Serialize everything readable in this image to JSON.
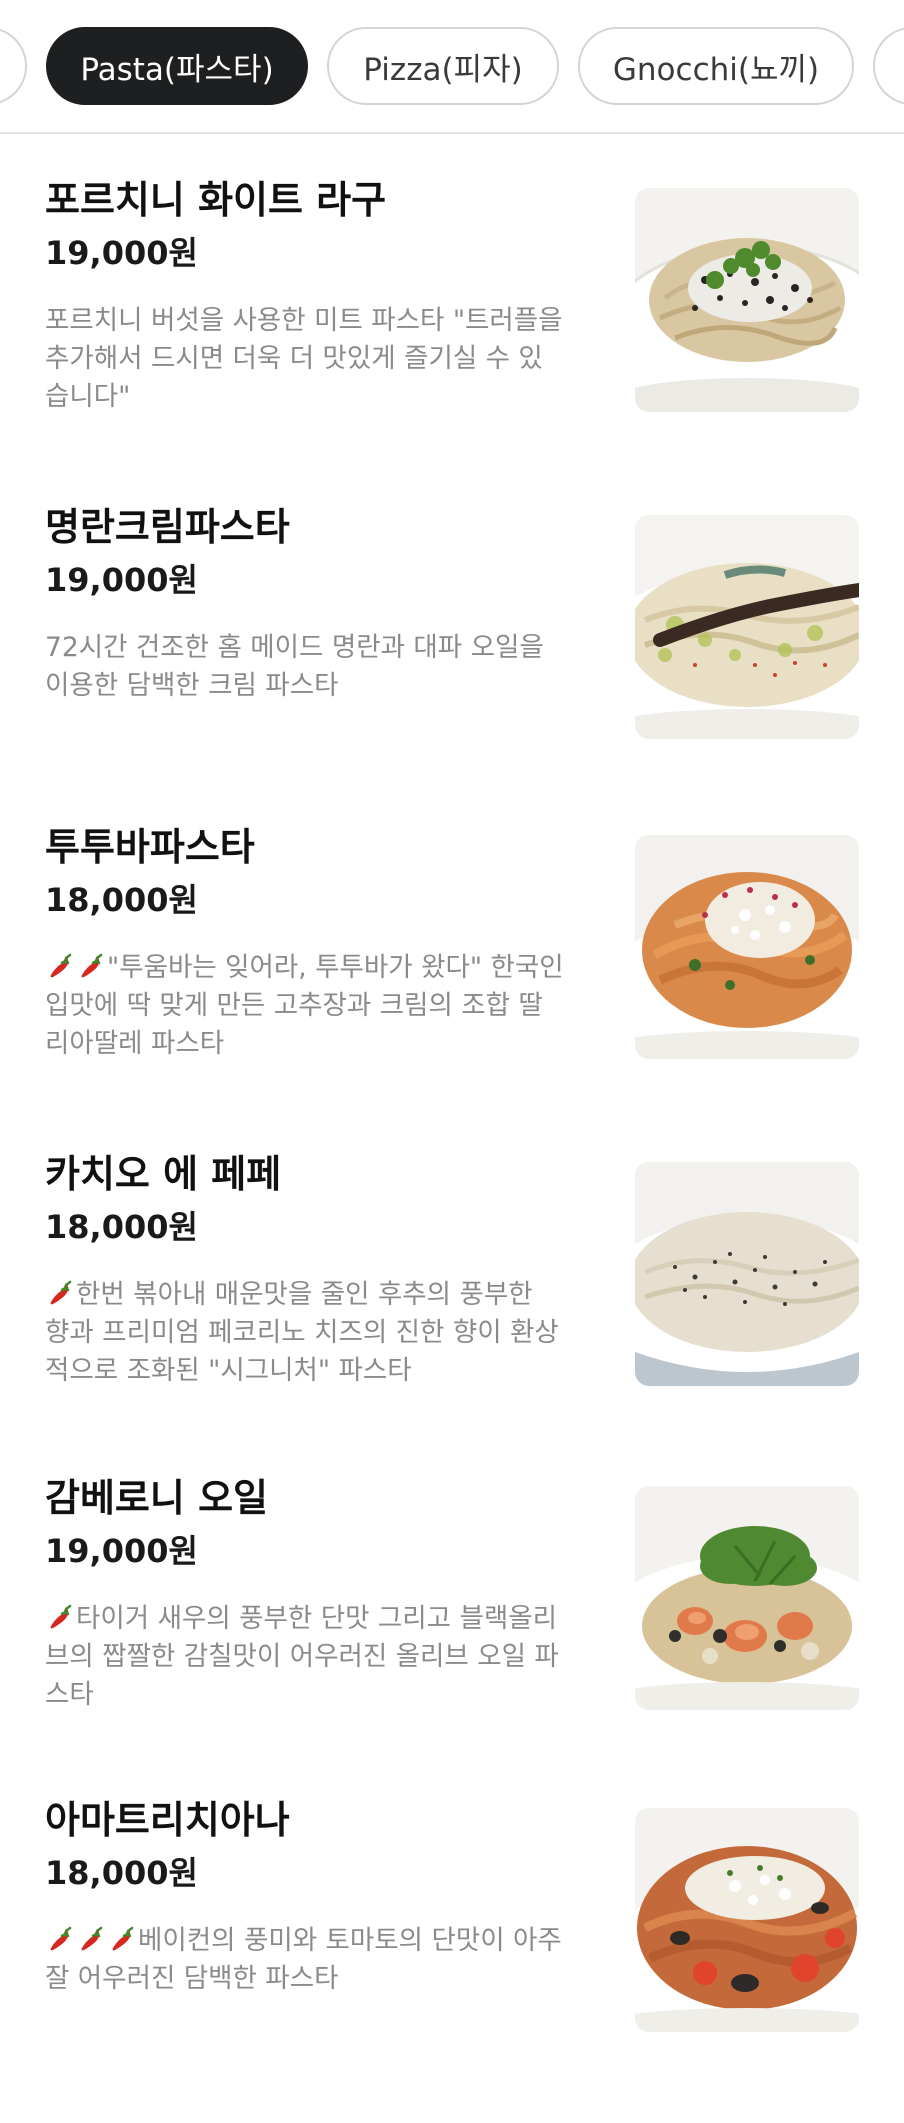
{
  "categories": {
    "prev_label": "",
    "items": [
      {
        "label": "Pasta(파스타)",
        "active": true
      },
      {
        "label": "Pizza(피자)",
        "active": false
      },
      {
        "label": "Gnocchi(뇨끼)",
        "active": false
      }
    ],
    "next_label": ""
  },
  "menu": [
    {
      "name": "포르치니 화이트 라구",
      "price": "19,000원",
      "spice_level": 0,
      "description": "포르치니 버섯을 사용한 미트 파스타 \"트러플을 추가해서 드시면 더욱 더 맛있게 즐기실 수 있습니다\"",
      "image": "porcini-white-ragu-photo"
    },
    {
      "name": "명란크림파스타",
      "price": "19,000원",
      "spice_level": 0,
      "description": "72시간 건조한 홈 메이드 명란과 대파 오일을 이용한 담백한 크림 파스타",
      "image": "myeongran-cream-pasta-photo"
    },
    {
      "name": "투투바파스타",
      "price": "18,000원",
      "spice_level": 2,
      "description": "\"투움바는 잊어라, 투투바가 왔다\" 한국인 입맛에 딱 맞게 만든 고추장과 크림의 조합 딸리아딸레 파스타",
      "image": "tutuba-pasta-photo"
    },
    {
      "name": "카치오 에 페페",
      "price": "18,000원",
      "spice_level": 1,
      "description": "한번 볶아내 매운맛을 줄인 후추의 풍부한 향과 프리미엄 페코리노 치즈의 진한 향이 환상적으로 조화된 \"시그니처\" 파스타",
      "image": "cacio-e-pepe-photo"
    },
    {
      "name": "감베로니 오일",
      "price": "19,000원",
      "spice_level": 1,
      "description": "타이거 새우의 풍부한 단맛 그리고 블랙올리브의 짭짤한 감칠맛이 어우러진 올리브 오일 파스타",
      "image": "gamberoni-oil-photo"
    },
    {
      "name": "아마트리치아나",
      "price": "18,000원",
      "spice_level": 3,
      "description": "베이컨의 풍미와 토마토의 단맛이 아주 잘 어우러진 담백한 파스타",
      "image": "amatriciana-photo"
    }
  ],
  "colors": {
    "active_chip_bg": "#1e1f21",
    "chip_border": "#d4d4d4",
    "description_text": "#8a8a8a",
    "pepper_red": "#d6281e"
  }
}
